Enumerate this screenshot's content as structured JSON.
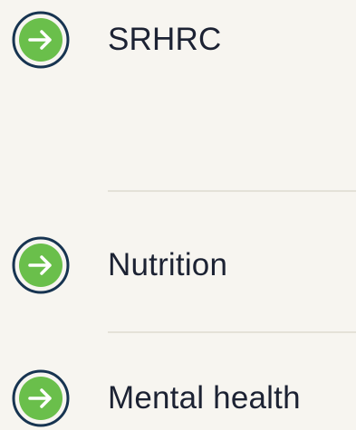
{
  "topics": [
    {
      "label": "SRHRC",
      "icon": "arrow-right-circle-icon"
    },
    {
      "label": "Nutrition",
      "icon": "arrow-right-circle-icon"
    },
    {
      "label": "Mental health",
      "icon": "arrow-right-circle-icon"
    }
  ],
  "colors": {
    "background": "#f7f5f0",
    "icon_fill": "#6abf4b",
    "icon_ring": "#173451",
    "text": "#1c2233",
    "divider": "#e4e1d8"
  }
}
